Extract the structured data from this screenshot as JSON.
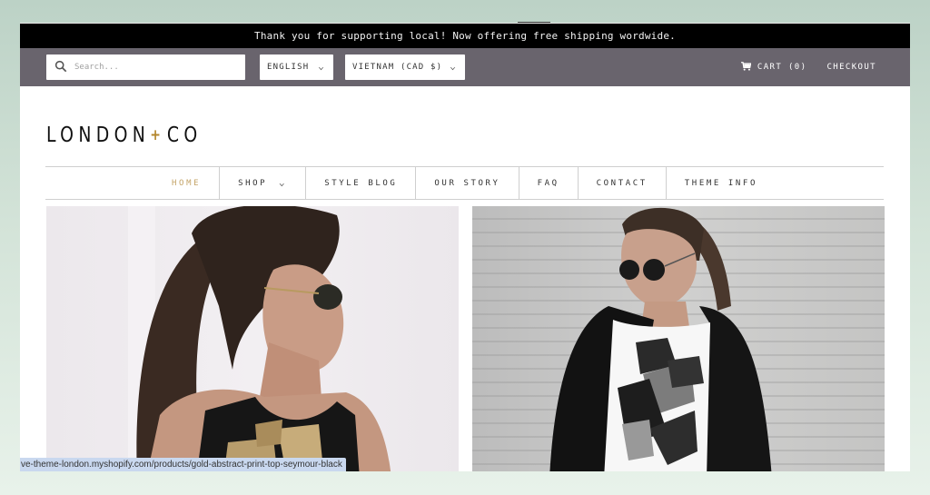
{
  "announcement": "Thank you for supporting local! Now offering free shipping wordwide.",
  "topbar": {
    "search": {
      "placeholder": "Search...",
      "value": ""
    },
    "language": {
      "selected": "ENGLISH"
    },
    "country": {
      "selected": "VIETNAM (CAD $)"
    },
    "cart_label": "CART (0)",
    "checkout_label": "CHECKOUT"
  },
  "logo": {
    "left": "LONDON",
    "plus": "+",
    "right": "CO"
  },
  "nav": {
    "items": [
      {
        "label": "HOME",
        "active": true,
        "has_dropdown": false
      },
      {
        "label": "SHOP",
        "active": false,
        "has_dropdown": true
      },
      {
        "label": "STYLE BLOG",
        "active": false,
        "has_dropdown": false
      },
      {
        "label": "OUR STORY",
        "active": false,
        "has_dropdown": false
      },
      {
        "label": "FAQ",
        "active": false,
        "has_dropdown": false
      },
      {
        "label": "CONTACT",
        "active": false,
        "has_dropdown": false
      },
      {
        "label": "THEME INFO",
        "active": false,
        "has_dropdown": false
      }
    ]
  },
  "hero": {
    "left": {
      "alt": "Woman in sunglasses wearing black top with gold abstract print"
    },
    "right": {
      "alt": "Woman in round sunglasses wearing black jacket over white geometric print tee"
    }
  },
  "status_url": "ve-theme-london.myshopify.com/products/gold-abstract-print-top-seymour-black",
  "colors": {
    "announcement_bg": "#000000",
    "topbar_bg": "#69646d",
    "accent_gold": "#b3862b",
    "nav_active": "#c4a468"
  },
  "icons": {
    "search": "search-icon",
    "cart": "cart-icon",
    "chevron": "chevron-down-icon"
  }
}
